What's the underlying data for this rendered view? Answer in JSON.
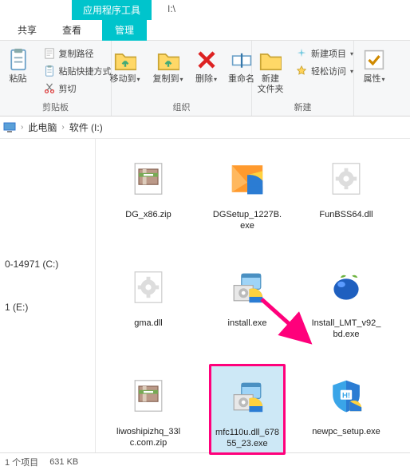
{
  "window": {
    "tool_tab": "应用程序工具",
    "title": "I:\\"
  },
  "ribbon_tabs": {
    "share": "共享",
    "view": "查看",
    "manage": "管理"
  },
  "ribbon": {
    "clipboard": {
      "paste": "粘贴",
      "copy_path": "复制路径",
      "paste_shortcut": "粘贴快捷方式",
      "cut": "剪切",
      "label": "剪贴板"
    },
    "organize": {
      "move_to": "移动到",
      "copy_to": "复制到",
      "delete": "删除",
      "rename": "重命名",
      "label": "组织"
    },
    "new": {
      "new_folder": "新建\n文件夹",
      "new_item": "新建项目",
      "easy_access": "轻松访问",
      "label": "新建"
    },
    "properties": {
      "label": "属性"
    }
  },
  "crumbs": {
    "this_pc": "此电脑",
    "drive": "软件 (I:)"
  },
  "nav": {
    "c": "0-14971 (C:)",
    "e": "1 (E:)"
  },
  "files": [
    {
      "name": "DG_x86.zip",
      "icon": "zip"
    },
    {
      "name": "DGSetup_1227B.exe",
      "icon": "setup-orange"
    },
    {
      "name": "FunBSS64.dll",
      "icon": "dll"
    },
    {
      "name": "gma.dll",
      "icon": "dll"
    },
    {
      "name": "install.exe",
      "icon": "installer"
    },
    {
      "name": "Install_LMT_v92_bd.exe",
      "icon": "blue-app"
    },
    {
      "name": "liwoshipizhq_33lc.com.zip",
      "icon": "zip"
    },
    {
      "name": "mfc110u.dll_67855_23.exe",
      "icon": "installer",
      "selected": true
    },
    {
      "name": "newpc_setup.exe",
      "icon": "shield-h"
    }
  ],
  "status": {
    "selected": "1 个项目",
    "size": "631 KB"
  },
  "colors": {
    "accent": "#00c4cc",
    "highlight": "#ff007b",
    "select_bg": "#cde8f6"
  }
}
